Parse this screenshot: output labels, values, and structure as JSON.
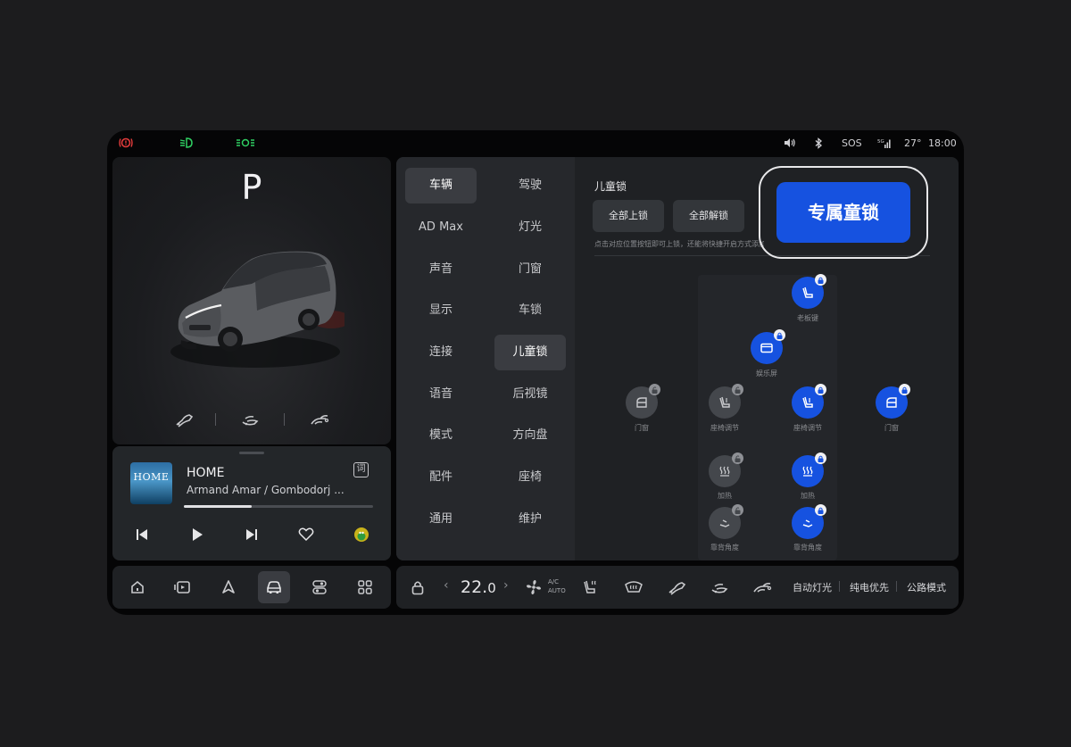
{
  "status": {
    "bluetooth_icon": "bluetooth-icon",
    "sos": "SOS",
    "signal": "5G",
    "temperature": "27°",
    "time": "18:00",
    "indicator_colors": {
      "brake": "#e23b3b",
      "low_beam": "#2fcf62",
      "position_lights": "#2fcf62"
    }
  },
  "vehicle": {
    "gear": "P",
    "actions": [
      "front-trunk-icon",
      "charge-port-icon",
      "rear-trunk-icon"
    ]
  },
  "music": {
    "album_text": "HOME",
    "title": "HOME",
    "artist": "Armand Amar / Gombodorj ...",
    "lyric_label": "词",
    "progress": 0.36
  },
  "nav": {
    "items": [
      "home-icon",
      "media-icon",
      "navigation-icon",
      "car-icon",
      "controls-icon",
      "apps-icon"
    ],
    "active": 3
  },
  "menu": {
    "left": [
      "车辆",
      "AD Max",
      "声音",
      "显示",
      "连接",
      "语音",
      "模式",
      "配件",
      "通用"
    ],
    "right": [
      "驾驶",
      "灯光",
      "门窗",
      "车锁",
      "儿童锁",
      "后视镜",
      "方向盘",
      "座椅",
      "维护"
    ]
  },
  "child_lock": {
    "title": "儿童锁",
    "lock_all": "全部上锁",
    "unlock_all": "全部解锁",
    "hint": "点击对应位置按钮即可上锁，还能将快捷开启方式添加",
    "exclusive_button": "专属童锁",
    "labels": {
      "boss_key": "老板键",
      "entertainment": "娱乐屏",
      "door_left": "门窗",
      "seat_adjust_left": "座椅调节",
      "seat_adjust_right": "座椅调节",
      "door_right": "门窗",
      "heat_left": "加热",
      "heat_right": "加热",
      "recline_left": "靠背角度",
      "recline_right": "靠背角度"
    },
    "active_color": "#1652e0"
  },
  "climate": {
    "temp_main": "22.",
    "temp_decimal": "0",
    "ac_line1": "A/C",
    "ac_line2": "AUTO",
    "modes": [
      "自动灯光",
      "纯电优先",
      "公路模式"
    ]
  }
}
